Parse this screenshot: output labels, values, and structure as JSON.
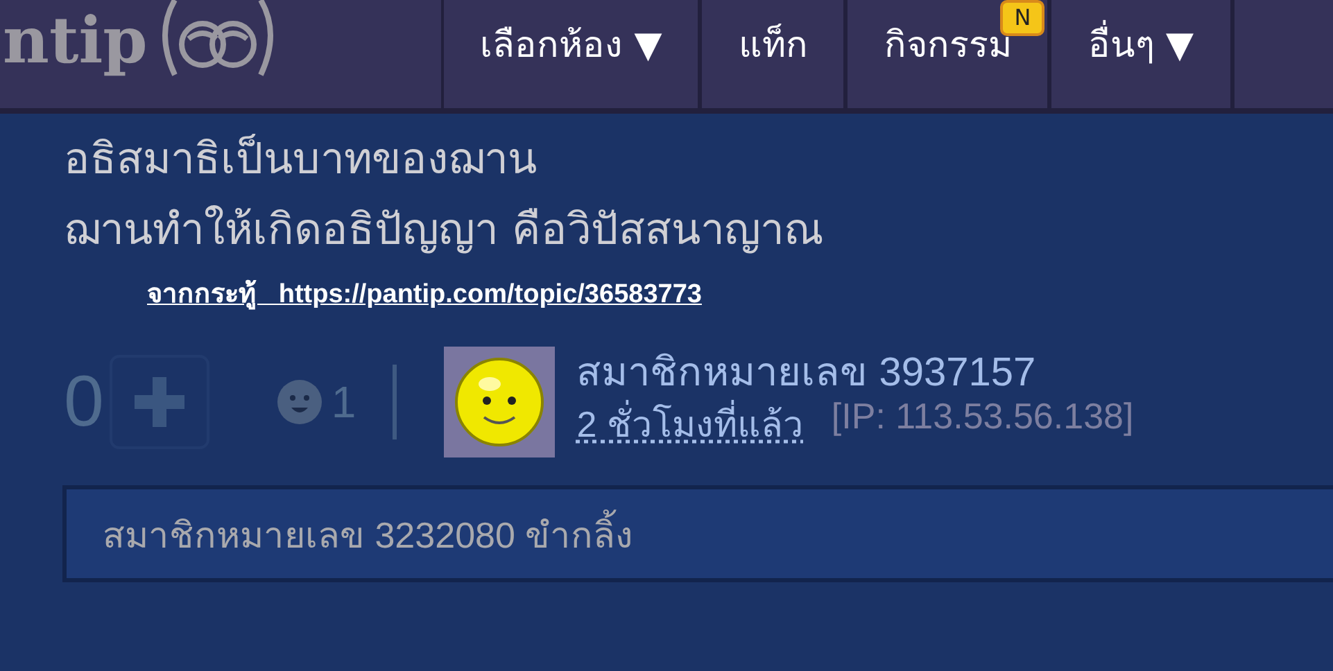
{
  "header": {
    "logo_text": "ntip",
    "nav": [
      {
        "label": "เลือกห้อง ▼"
      },
      {
        "label": "แท็ก"
      },
      {
        "label": "กิจกรรม",
        "badge": "N"
      },
      {
        "label": "อื่นๆ ▼"
      }
    ]
  },
  "post": {
    "lines": [
      "อธิสมาธิเป็นบาทของฌาน",
      "ฌานทำให้เกิดอธิปัญญา คือวิปัสสนาญาณ"
    ],
    "source_link": "จากกระทู้   https://pantip.com/topic/36583773"
  },
  "meta": {
    "vote_count": "0",
    "emotion_count": "1",
    "author": "สมาชิกหมายเลข 3937157",
    "time": "2 ชั่วโมงที่แล้ว",
    "ip": "[IP: 113.53.56.138]"
  },
  "reply": {
    "text": "สมาชิกหมายเลข 3232080 ขำกลิ้ง"
  }
}
